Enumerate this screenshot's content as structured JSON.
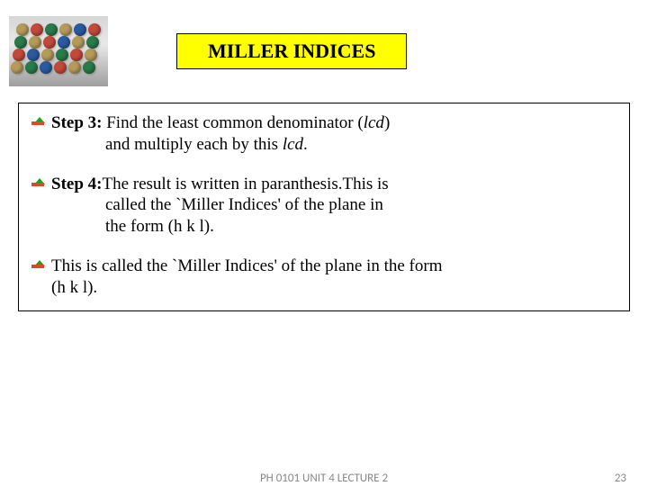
{
  "title": "MILLER INDICES",
  "items": [
    {
      "label": "Step 3:",
      "line1a": " Find the least common denominator (",
      "line1_ital": "lcd",
      "line1b": ")",
      "line2a": "and multiply each by this ",
      "line2_ital": "lcd",
      "line2b": "."
    },
    {
      "label": "Step 4:",
      "line1": "The result is written in paranthesis.This is",
      "line2": "called the `Miller Indices' of the plane in",
      "line3": "the form (h k l)."
    },
    {
      "line1": "This is called the `Miller Indices' of the plane in the form",
      "line2": "(h k l)."
    }
  ],
  "footer": {
    "center": "PH 0101  UNIT 4  LECTURE 2",
    "page": "23"
  }
}
